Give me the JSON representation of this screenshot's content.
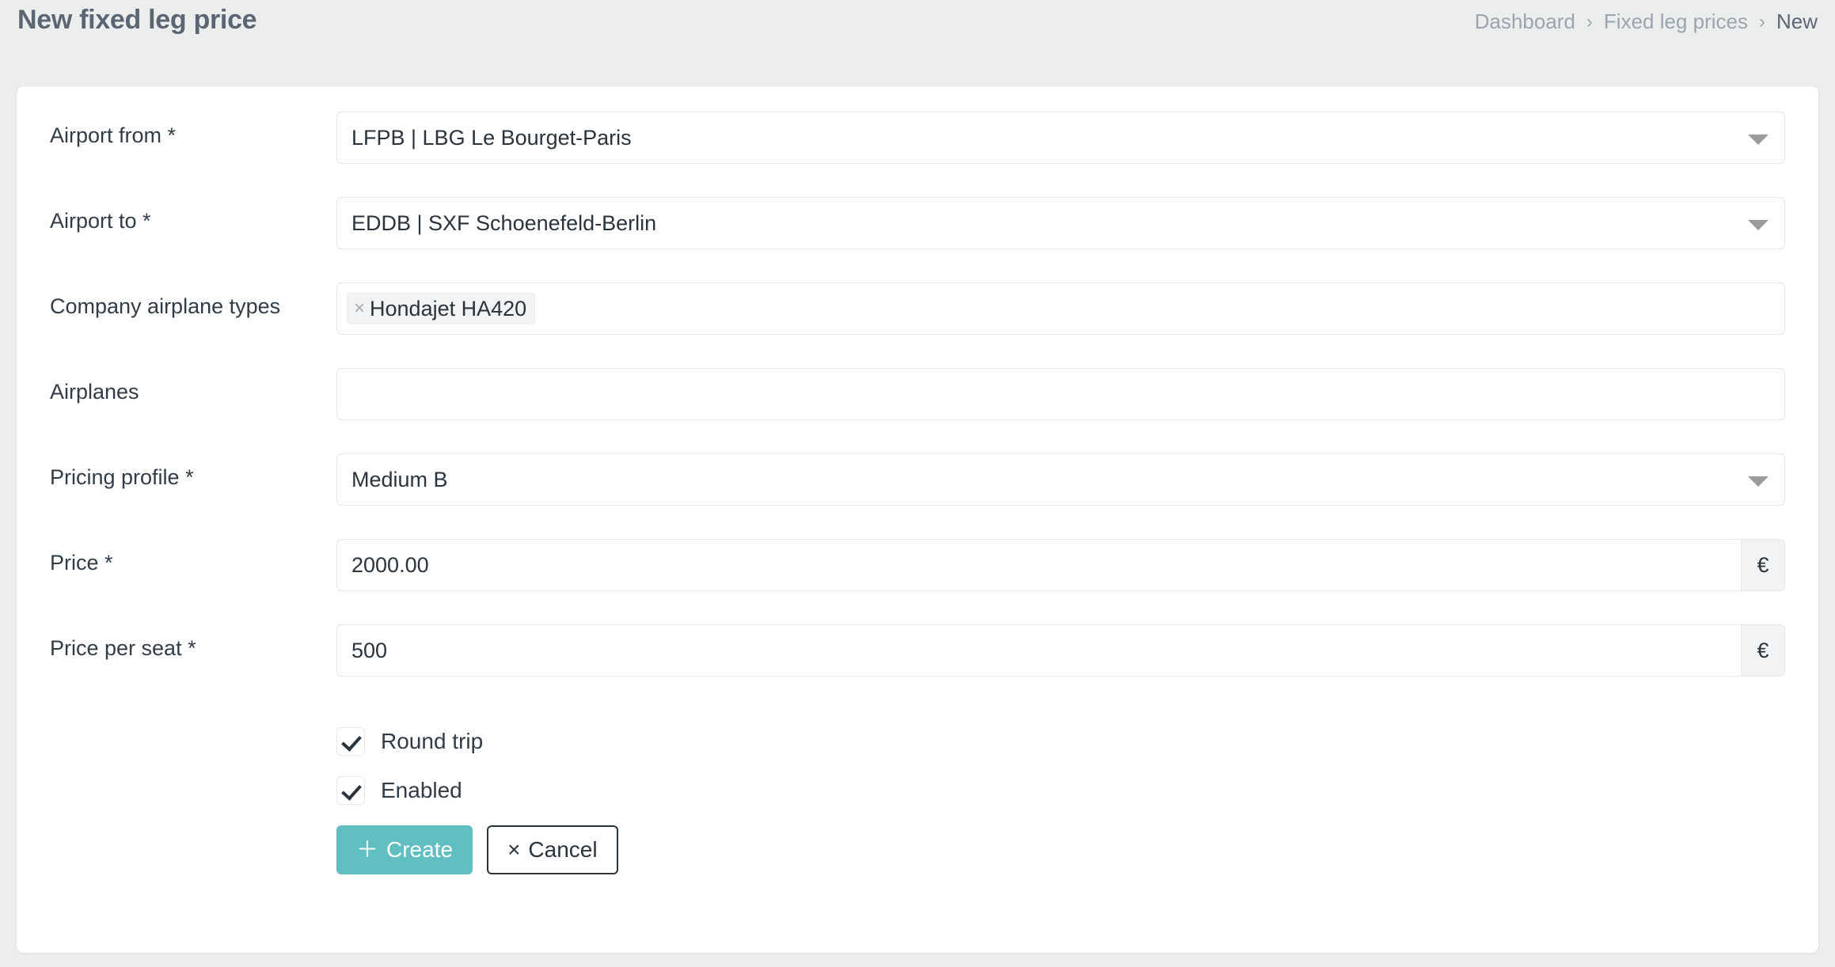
{
  "header": {
    "title": "New fixed leg price",
    "breadcrumb": [
      {
        "label": "Dashboard",
        "current": false
      },
      {
        "label": "Fixed leg prices",
        "current": false
      },
      {
        "label": "New",
        "current": true
      }
    ],
    "separator": "›"
  },
  "form": {
    "fields": [
      {
        "label": "Airport from *",
        "type": "select",
        "value": "LFPB | LBG Le Bourget-Paris",
        "icon": "chevron-down-icon"
      },
      {
        "label": "Airport to *",
        "type": "select",
        "value": "EDDB | SXF Schoenefeld-Berlin",
        "icon": "chevron-down-icon"
      },
      {
        "label": "Company airplane types",
        "type": "tags",
        "value": "",
        "tags": [
          {
            "label": "Hondajet HA420",
            "remove": "×"
          }
        ]
      },
      {
        "label": "Airplanes",
        "type": "tags",
        "value": "",
        "tags": []
      },
      {
        "label": "Pricing profile *",
        "type": "select",
        "value": "Medium B",
        "icon": "chevron-down-icon"
      },
      {
        "label": "Price *",
        "type": "currency",
        "value": "2000.00",
        "addon": "€"
      },
      {
        "label": "Price per seat *",
        "type": "currency",
        "value": "500",
        "addon": "€"
      }
    ],
    "checkboxes": [
      {
        "label": "Round trip",
        "checked": true
      },
      {
        "label": "Enabled",
        "checked": true
      }
    ],
    "buttons": {
      "create": {
        "label": "Create",
        "icon": "＋"
      },
      "cancel": {
        "label": "Cancel",
        "icon": "×"
      }
    }
  },
  "colors": {
    "accent": "#61bec2",
    "page_bg": "#eceeee",
    "card_bg": "#ffffff",
    "text": "#323c47",
    "muted": "#9aa5ad"
  }
}
